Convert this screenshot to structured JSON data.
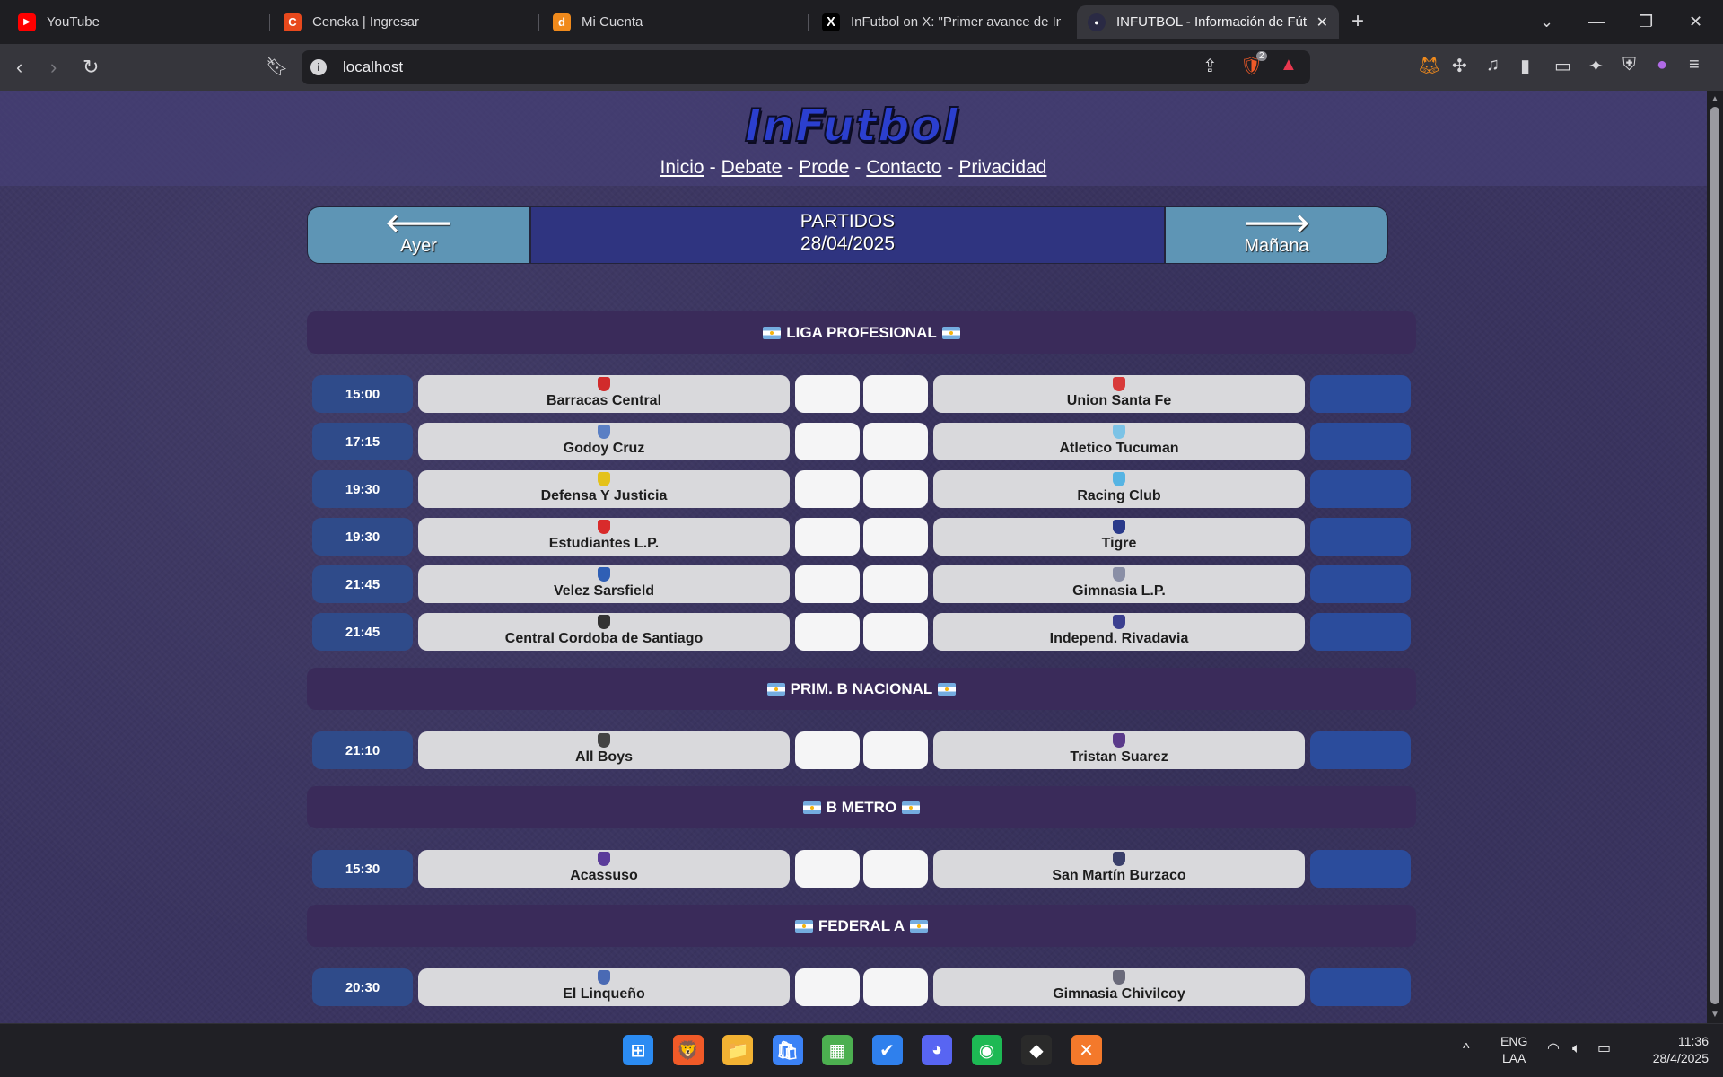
{
  "browser": {
    "tabs": [
      {
        "title": "YouTube",
        "icon": "youtube-icon",
        "color": "#ff0000",
        "glyph": "▶"
      },
      {
        "title": "Ceneka | Ingresar",
        "icon": "ceneka-icon",
        "color": "#e8491d",
        "glyph": "C"
      },
      {
        "title": "Mi Cuenta",
        "icon": "dinahosting-icon",
        "color": "#f08a1c",
        "glyph": "d"
      },
      {
        "title": "InFutbol on X: \"Primer avance de InF",
        "icon": "x-icon",
        "color": "#000000",
        "glyph": "𝕏"
      },
      {
        "title": "INFUTBOL - Información de Fútbol",
        "icon": "infutbol-tab-icon",
        "color": "#3a3460",
        "glyph": "●"
      }
    ],
    "new_tab": "+",
    "url": "localhost",
    "extension_badge": "2"
  },
  "site": {
    "logo_text": "InFutbol",
    "nav": [
      "Inicio",
      "Debate",
      "Prode",
      "Contacto",
      "Privacidad"
    ],
    "nav_sep": "-",
    "date_bar": {
      "prev_label": "Ayer",
      "next_label": "Mañana",
      "title": "PARTIDOS",
      "date": "28/04/2025",
      "prev_arrow": "🡐",
      "next_arrow": "🡒"
    }
  },
  "leagues": [
    {
      "name": "LIGA PROFESIONAL",
      "matches": [
        {
          "time": "15:00",
          "home": "Barracas Central",
          "home_color": "#d12b2b",
          "away": "Union Santa Fe",
          "away_color": "#d83a3a",
          "home_score": "",
          "away_score": ""
        },
        {
          "time": "17:15",
          "home": "Godoy Cruz",
          "home_color": "#5a7fc4",
          "away": "Atletico Tucuman",
          "away_color": "#7cc3e6",
          "home_score": "",
          "away_score": ""
        },
        {
          "time": "19:30",
          "home": "Defensa Y Justicia",
          "home_color": "#e4c21a",
          "away": "Racing Club",
          "away_color": "#56b4e3",
          "home_score": "",
          "away_score": ""
        },
        {
          "time": "19:30",
          "home": "Estudiantes L.P.",
          "home_color": "#d92b2b",
          "away": "Tigre",
          "away_color": "#2a3a8a",
          "home_score": "",
          "away_score": ""
        },
        {
          "time": "21:45",
          "home": "Velez Sarsfield",
          "home_color": "#2f5fb5",
          "away": "Gimnasia L.P.",
          "away_color": "#8a8fa6",
          "home_score": "",
          "away_score": ""
        },
        {
          "time": "21:45",
          "home": "Central Cordoba de Santiago",
          "home_color": "#333333",
          "away": "Independ. Rivadavia",
          "away_color": "#3b3f8f",
          "home_score": "",
          "away_score": ""
        }
      ]
    },
    {
      "name": "PRIM. B NACIONAL",
      "matches": [
        {
          "time": "21:10",
          "home": "All Boys",
          "home_color": "#444444",
          "away": "Tristan Suarez",
          "away_color": "#5a3a8a",
          "home_score": "",
          "away_score": ""
        }
      ]
    },
    {
      "name": "B METRO",
      "matches": [
        {
          "time": "15:30",
          "home": "Acassuso",
          "home_color": "#5b3c9a",
          "away": "San Martín Burzaco",
          "away_color": "#3a3f6a",
          "home_score": "",
          "away_score": ""
        }
      ]
    },
    {
      "name": "FEDERAL A",
      "matches": [
        {
          "time": "20:30",
          "home": "El Linqueño",
          "home_color": "#4a6ab4",
          "away": "Gimnasia Chivilcoy",
          "away_color": "#6a6a7a",
          "home_score": "",
          "away_score": ""
        }
      ]
    }
  ],
  "taskbar": {
    "apps": [
      {
        "name": "windows-start-icon",
        "glyph": "⊞",
        "color": "#2b8bf2"
      },
      {
        "name": "brave-browser-icon",
        "glyph": "🦁",
        "color": "#f05a28"
      },
      {
        "name": "file-explorer-icon",
        "glyph": "📁",
        "color": "#f2b233"
      },
      {
        "name": "microsoft-store-icon",
        "glyph": "🛍",
        "color": "#3b82f6"
      },
      {
        "name": "minecraft-icon",
        "glyph": "▦",
        "color": "#4caf50"
      },
      {
        "name": "todo-icon",
        "glyph": "✔",
        "color": "#2f80ed"
      },
      {
        "name": "discord-icon",
        "glyph": "◕",
        "color": "#5865f2"
      },
      {
        "name": "spotify-icon",
        "glyph": "◉",
        "color": "#1db954"
      },
      {
        "name": "epic-games-icon",
        "glyph": "◆",
        "color": "#2a2a2a"
      },
      {
        "name": "xampp-icon",
        "glyph": "✕",
        "color": "#f4792b"
      }
    ],
    "lang_top": "ENG",
    "lang_bottom": "LAA",
    "time": "11:36",
    "date": "28/4/2025"
  }
}
